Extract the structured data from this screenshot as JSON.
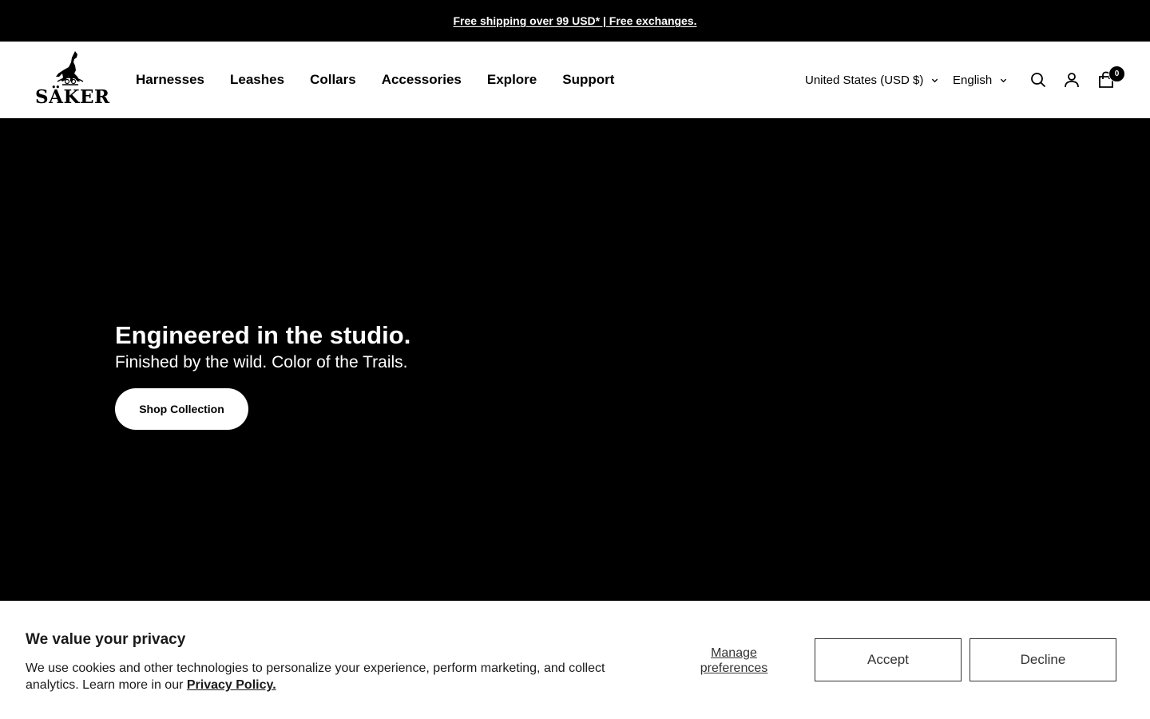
{
  "announcement": {
    "text": "Free shipping over 99 USD* | Free exchanges."
  },
  "header": {
    "logo_text": "SÄKER",
    "nav": [
      {
        "label": "Harnesses"
      },
      {
        "label": "Leashes"
      },
      {
        "label": "Collars"
      },
      {
        "label": "Accessories"
      },
      {
        "label": "Explore"
      },
      {
        "label": "Support"
      }
    ],
    "country_selector": {
      "value": "United States (USD $)",
      "icon": "chevron-down-icon"
    },
    "language_selector": {
      "value": "English",
      "icon": "chevron-down-icon"
    },
    "icons": [
      "search-icon",
      "account-icon",
      "cart-icon"
    ],
    "cart_count": "0"
  },
  "hero": {
    "title": "Engineered in the studio.",
    "subtitle": "Finished by the wild. Color of the Trails.",
    "cta_label": "Shop Collection"
  },
  "cookie_banner": {
    "title": "We value your privacy",
    "body": "We use cookies and other technologies to personalize your experience, perform marketing, and collect analytics. Learn more in our ",
    "policy_link": "Privacy Policy.",
    "manage_label": "Manage preferences",
    "accept_label": "Accept",
    "decline_label": "Decline"
  }
}
